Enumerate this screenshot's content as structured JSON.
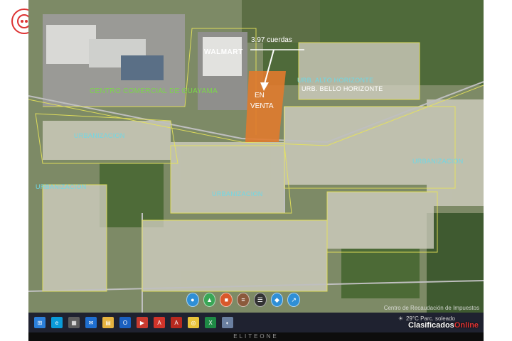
{
  "map": {
    "acreage_label": "3.97 cuerdas",
    "walmart_label": "WALMART",
    "en_label": "EN",
    "venta_label": "VENTA",
    "mall_label": "CENTRO COMERCIAL DE GUAYAMA",
    "urb_alto_label": "URB. ALTO HORIZONTE",
    "urb_bello_label": "URB. BELLO HORIZONTE",
    "urb_label_1": "URBANIZACION",
    "urb_label_2": "URBANIZACION",
    "urb_label_3": "URBANIZACION",
    "urb_label_4": "URBANIZACION"
  },
  "screen": {
    "watermark": "Centro de Recaudación de Impuestos"
  },
  "taskbar": {
    "weather": "29°C  Parc. soleado",
    "icons": [
      "windows-start",
      "edge",
      "calendar",
      "mail",
      "files",
      "outlook",
      "media",
      "acrobat",
      "adobe",
      "chrome",
      "excel",
      "photos"
    ]
  },
  "monitor": {
    "brand": "ELITEONE"
  },
  "site": {
    "brand_a": "Clasificados",
    "brand_b": "Online"
  },
  "colors": {
    "parcel_highlight": "#e07a2e",
    "boundary_lines": "#e8e45a",
    "urb_label": "#6fd8e6"
  }
}
